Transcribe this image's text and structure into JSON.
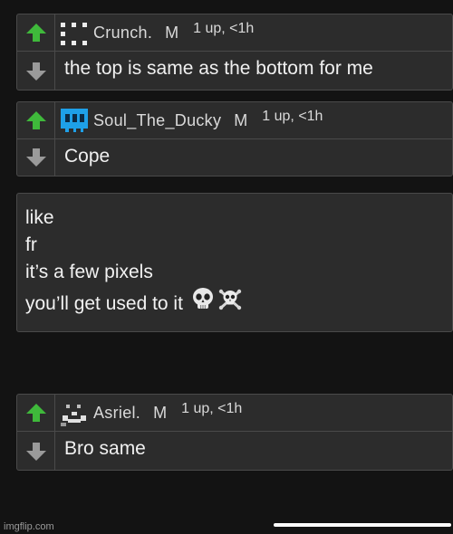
{
  "colors": {
    "background": "#131313",
    "card": "#2c2c2c",
    "border": "#4a4a4a",
    "upvote_green": "#3fb93b",
    "downvote_gray": "#9a9a9a",
    "ducky_blue": "#1ea0e8"
  },
  "comments": [
    {
      "username": "Crunch.",
      "badge": "M",
      "meta": "1 up, <1h",
      "text": "the top is same as the bottom for me",
      "avatar_icon": "dotted-pixel-avatar-icon"
    },
    {
      "username": "Soul_The_Ducky",
      "badge": "M",
      "meta": "1 up, <1h",
      "text": "Cope",
      "avatar_icon": "blue-pixel-ghost-avatar-icon"
    },
    {
      "username": "Asriel.",
      "badge": "M",
      "meta": "1 up, <1h",
      "text": "Bro same",
      "avatar_icon": "pixel-face-avatar-icon"
    }
  ],
  "note": {
    "lines": [
      "like",
      "fr",
      "it’s a few pixels",
      "you’ll get used to it"
    ],
    "emoji_icons": [
      "skull-emoji-icon",
      "skull-crossbones-emoji-icon"
    ]
  },
  "watermark": "imgflip.com",
  "vote_icons": {
    "up": "upvote-arrow-icon",
    "down": "downvote-arrow-icon"
  }
}
